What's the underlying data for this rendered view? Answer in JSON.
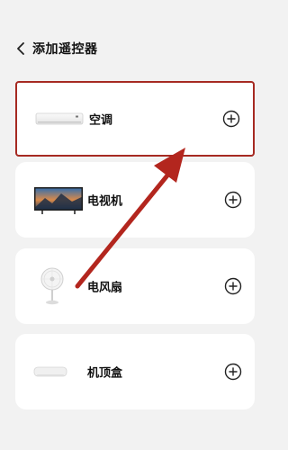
{
  "header": {
    "title": "添加遥控器",
    "back_icon": "chevron-left-icon"
  },
  "devices": [
    {
      "name": "空调",
      "icon": "air-conditioner-icon",
      "action_icon": "add-circle-icon",
      "highlighted": true
    },
    {
      "name": "电视机",
      "icon": "tv-icon",
      "action_icon": "add-circle-icon"
    },
    {
      "name": "电风扇",
      "icon": "fan-icon",
      "action_icon": "add-circle-icon"
    },
    {
      "name": "机顶盒",
      "icon": "set-top-box-icon",
      "action_icon": "add-circle-icon"
    }
  ],
  "colors": {
    "background": "#f2f2f2",
    "card": "#ffffff",
    "highlight": "#a62a22",
    "annotation_arrow": "#b3261e"
  }
}
